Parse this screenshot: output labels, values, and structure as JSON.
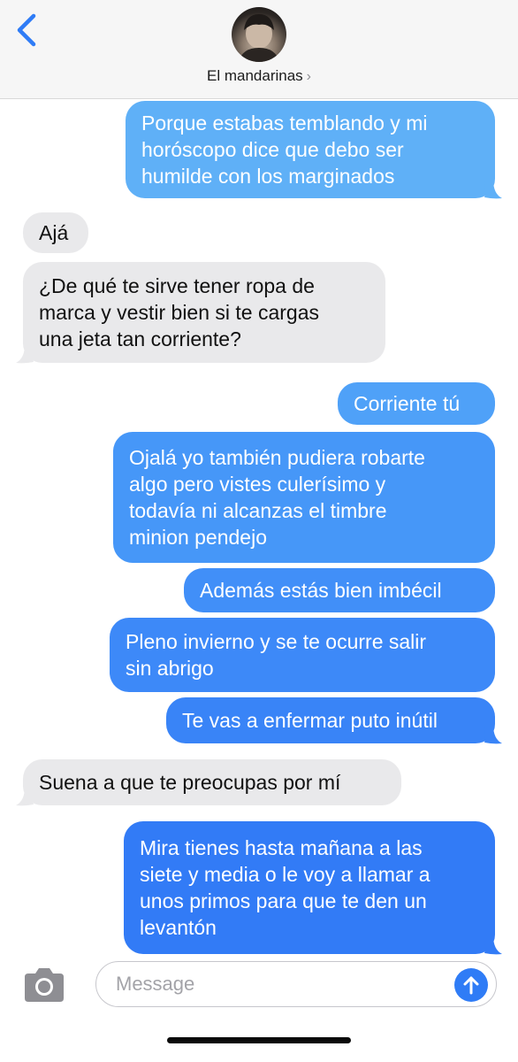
{
  "header": {
    "contact_name": "El mandarinas",
    "name_chevron": "›"
  },
  "messages": [
    {
      "direction": "sent",
      "lines": [
        "Porque estabas temblando y mi",
        "horóscopo dice que debo ser",
        "humilde con los marginados"
      ],
      "color": "#5fb0f7"
    },
    {
      "direction": "received",
      "lines": [
        "Ajá"
      ]
    },
    {
      "direction": "received",
      "lines": [
        "¿De qué te sirve tener ropa de",
        "marca y vestir bien si te cargas",
        "una jeta tan corriente?"
      ]
    },
    {
      "direction": "sent",
      "lines": [
        "Corriente tú"
      ],
      "color": "#4fa1f8"
    },
    {
      "direction": "sent",
      "lines": [
        "Ojalá yo también pudiera robarte",
        "algo pero vistes culerísimo y",
        "todavía ni alcanzas el timbre",
        "minion pendejo"
      ],
      "color": "#4697f8"
    },
    {
      "direction": "sent",
      "lines": [
        "Además estás bien imbécil"
      ],
      "color": "#418ff8"
    },
    {
      "direction": "sent",
      "lines": [
        "Pleno invierno y se te ocurre salir",
        "sin abrigo"
      ],
      "color": "#3d89f8"
    },
    {
      "direction": "sent",
      "lines": [
        "Te vas a enfermar puto inútil"
      ],
      "color": "#3984f7"
    },
    {
      "direction": "received",
      "lines": [
        "Suena a que te preocupas por mí"
      ]
    },
    {
      "direction": "sent",
      "lines": [
        "Mira tienes hasta mañana a las",
        "siete y media o le voy a llamar a",
        "unos primos para que te den un",
        "levantón"
      ],
      "color": "#327bf6"
    }
  ],
  "composer": {
    "placeholder": "Message",
    "value": ""
  },
  "colors": {
    "ios_blue": "#2f7cf6",
    "received_bubble": "#e9e9eb",
    "header_bg": "#f6f6f6"
  },
  "icons": {
    "back": "chevron-left-icon",
    "camera": "camera-icon",
    "send": "arrow-up-icon"
  }
}
